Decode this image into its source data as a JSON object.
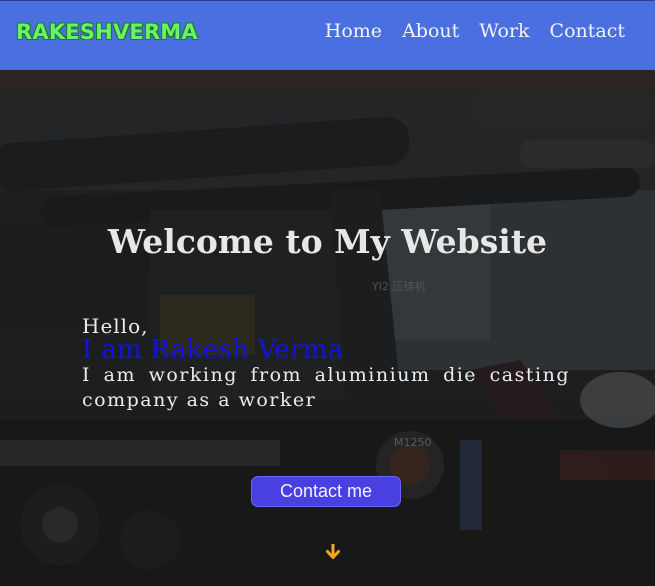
{
  "header": {
    "logo": "RAKESHVERMA",
    "nav": [
      "Home",
      "About",
      "Work",
      "Contact"
    ]
  },
  "hero": {
    "title": "Welcome to My Website",
    "greeting": "Hello,",
    "name_line": "I am Rakesh Verma",
    "description": "I am working from aluminium die casting company as a worker",
    "cta_label": "Contact me",
    "background_label_1": "YI2 压铸机",
    "background_label_2": "M1250"
  },
  "colors": {
    "navbar": "#4a6fe0",
    "logo": "#6cf06a",
    "name": "#1212e6",
    "cta": "#4a3fe0",
    "arrow": "#f5a623"
  },
  "icons": {
    "scroll": "arrow-down-icon"
  }
}
